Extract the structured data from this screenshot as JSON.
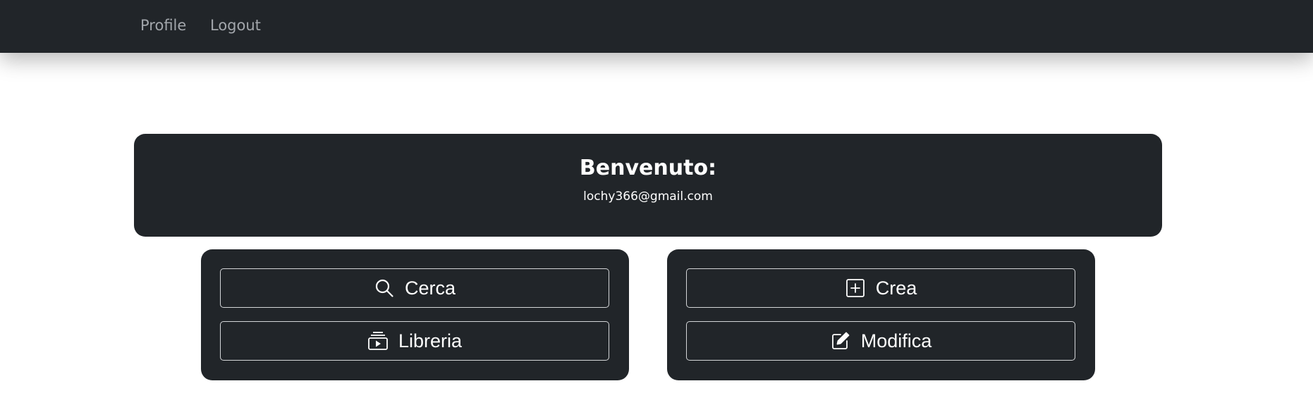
{
  "nav": {
    "profile": "Profile",
    "logout": "Logout"
  },
  "welcome": {
    "title": "Benvenuto:",
    "email": "lochy366@gmail.com"
  },
  "left_panel": {
    "buttons": [
      {
        "label": "Cerca",
        "icon": "search-icon"
      },
      {
        "label": "Libreria",
        "icon": "library-icon"
      }
    ]
  },
  "right_panel": {
    "buttons": [
      {
        "label": "Crea",
        "icon": "plus-square-icon"
      },
      {
        "label": "Modifica",
        "icon": "edit-icon"
      }
    ]
  },
  "colors": {
    "navbar": "#212529",
    "card": "#212529",
    "nav_link": "#a2a6ab",
    "text": "#ffffff",
    "button_border": "#d4d6d8"
  }
}
